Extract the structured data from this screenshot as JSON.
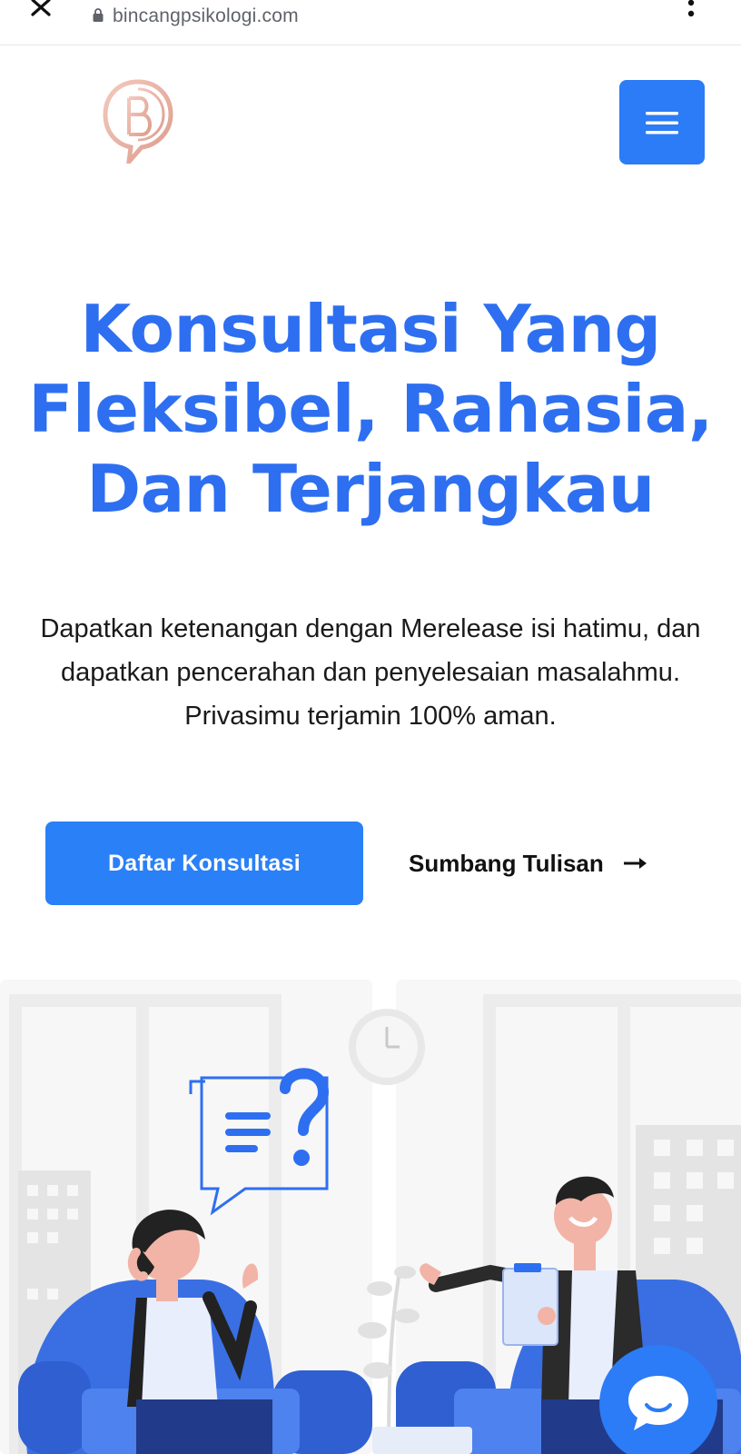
{
  "browser": {
    "url": "bincangpsikologi.com",
    "close_icon": "close-icon",
    "lock_icon": "lock-icon",
    "menu_icon": "kebab-menu-icon"
  },
  "header": {
    "logo_icon": "logo-b-icon",
    "menu_button_icon": "hamburger-icon"
  },
  "hero": {
    "title_lines": [
      "Konsultasi Yang",
      "Fleksibel, Rahasia,",
      "Dan Terjangkau"
    ],
    "description": "Dapatkan ketenangan dengan Merelease isi hatimu, dan dapatkan pencerahan dan penyelesaian masalahmu. Privasimu terjamin 100% aman.",
    "primary_cta": "Daftar Konsultasi",
    "secondary_cta": "Sumbang Tulisan"
  },
  "colors": {
    "brand_blue": "#2d6ff0",
    "button_blue": "#2a80f7",
    "logo_pink": "#e9b4a6"
  },
  "chat": {
    "icon": "chat-bubble-icon"
  }
}
